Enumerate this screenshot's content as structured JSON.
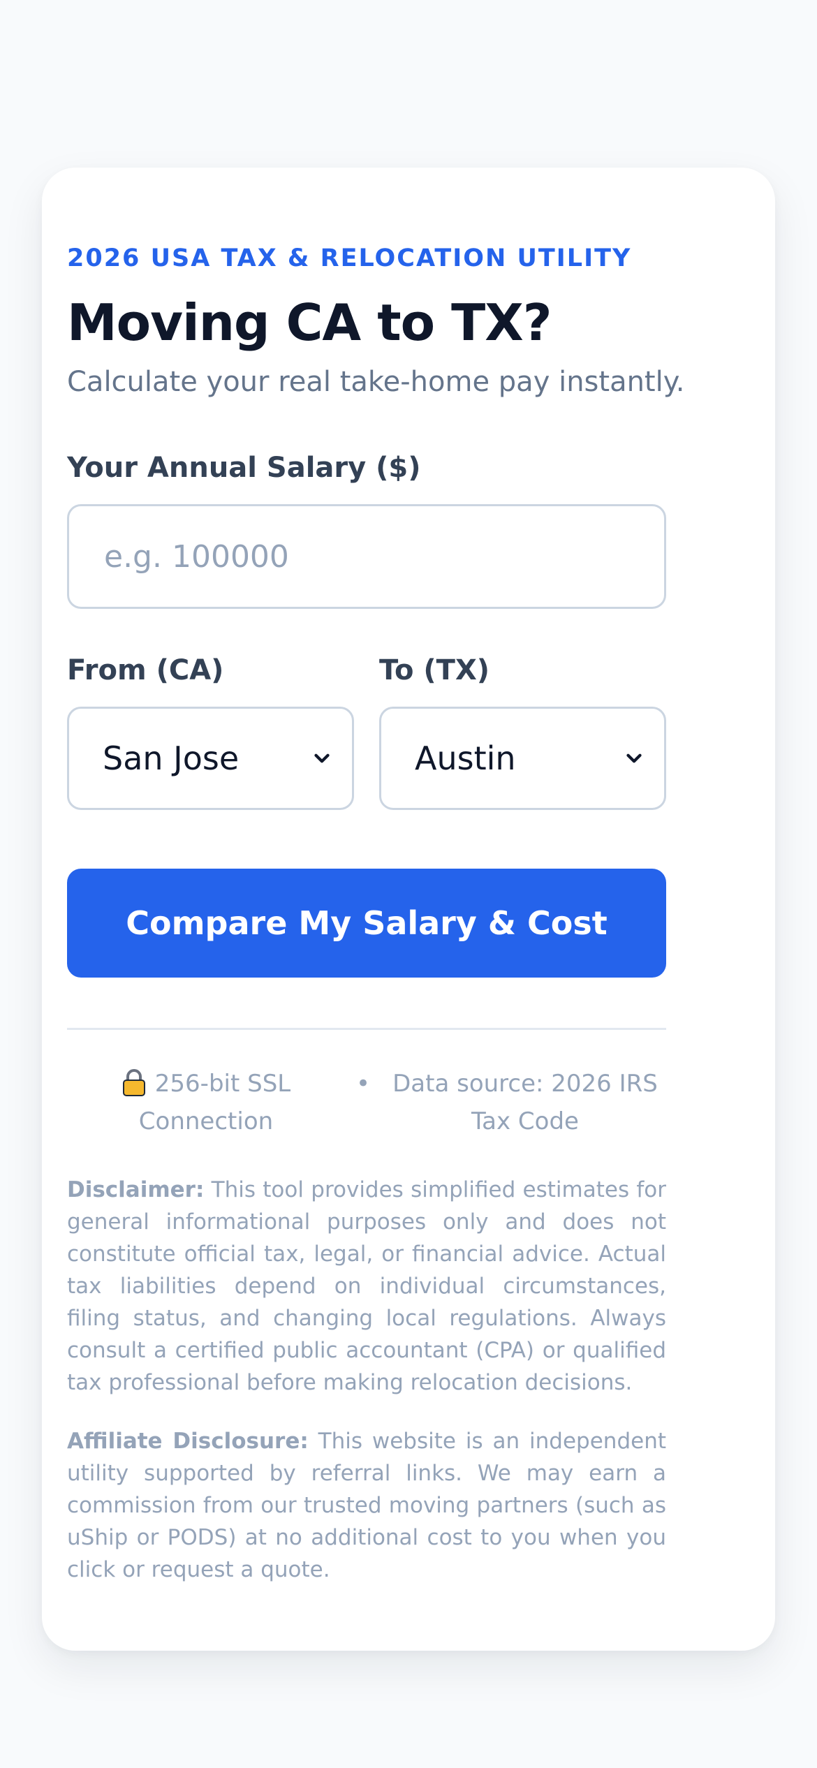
{
  "header": {
    "eyebrow": "2026 USA TAX & RELOCATION UTILITY",
    "title": "Moving CA to TX?",
    "subtitle": "Calculate your real take-home pay instantly."
  },
  "form": {
    "salary": {
      "label": "Your Annual Salary ($)",
      "placeholder": "e.g. 100000",
      "value": ""
    },
    "from": {
      "label": "From (CA)",
      "selected": "San Jose"
    },
    "to": {
      "label": "To (TX)",
      "selected": "Austin"
    },
    "submit_label": "Compare My Salary & Cost"
  },
  "trust": {
    "ssl": "256-bit SSL Connection",
    "separator": "•",
    "data_source": "Data source: 2026 IRS Tax Code"
  },
  "disclaimer": {
    "title": "Disclaimer:",
    "text": "This tool provides simplified estimates for general informational purposes only and does not constitute official tax, legal, or financial advice. Actual tax liabilities depend on individual circumstances, filing status, and changing local regulations. Always consult a certified public accountant (CPA) or qualified tax professional before making relocation decisions."
  },
  "affiliate": {
    "title": "Affiliate Disclosure:",
    "text": "This website is an independent utility supported by referral links. We may earn a commission from our trusted moving partners (such as uShip or PODS) at no additional cost to you when you click or request a quote."
  },
  "icons": {
    "lock": "lock-icon",
    "chevron": "chevron-down-icon"
  },
  "colors": {
    "accent": "#2563eb",
    "heading": "#0f172a",
    "muted": "#64748b",
    "faint": "#94a3b8",
    "background": "#f8fafc"
  }
}
